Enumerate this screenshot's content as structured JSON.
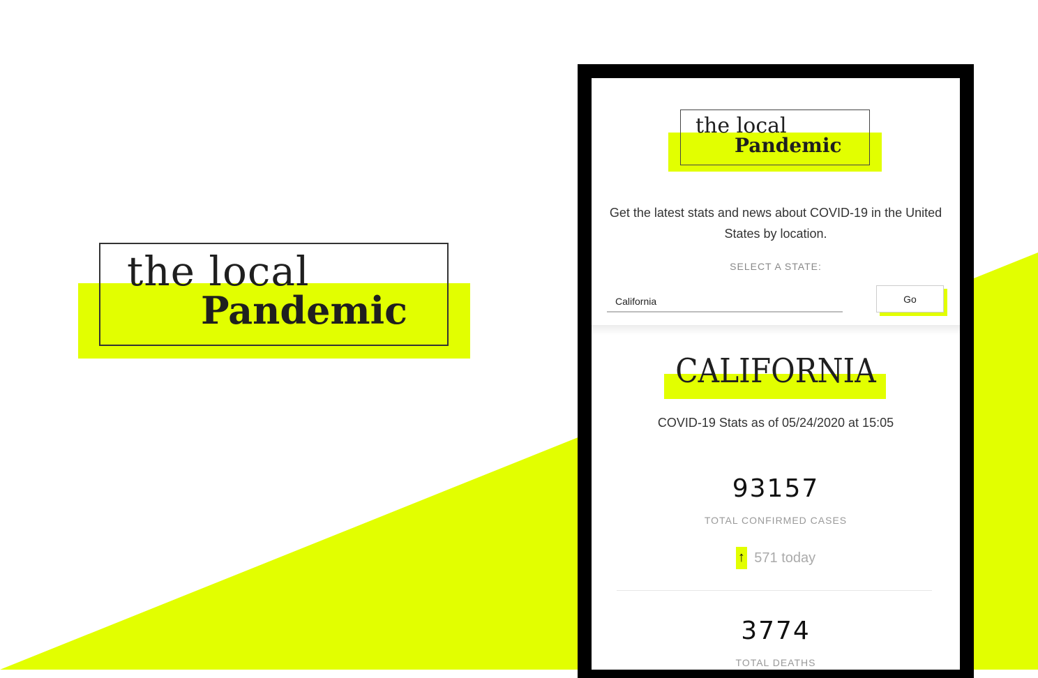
{
  "brand": {
    "line1": "the local",
    "line2": "Pandemic"
  },
  "colors": {
    "accent": "#e2ff00",
    "frame": "#000000",
    "text": "#1f1f1f"
  },
  "app": {
    "logo": {
      "line1": "the local",
      "line2": "Pandemic"
    },
    "intro": "Get the latest stats and news about COVID-19 in the United States by location.",
    "select_label": "SELECT A STATE:",
    "state_input": {
      "value": "California"
    },
    "go_button": "Go",
    "state_name": "CALIFORNIA",
    "stats_as_of": "COVID-19 Stats as of 05/24/2020 at 15:05",
    "confirmed": {
      "value": "93157",
      "label": "TOTAL CONFIRMED CASES",
      "delta_icon": "arrow-up-icon",
      "delta_text": "571 today"
    },
    "deaths": {
      "value": "3774",
      "label": "TOTAL DEATHS"
    }
  }
}
